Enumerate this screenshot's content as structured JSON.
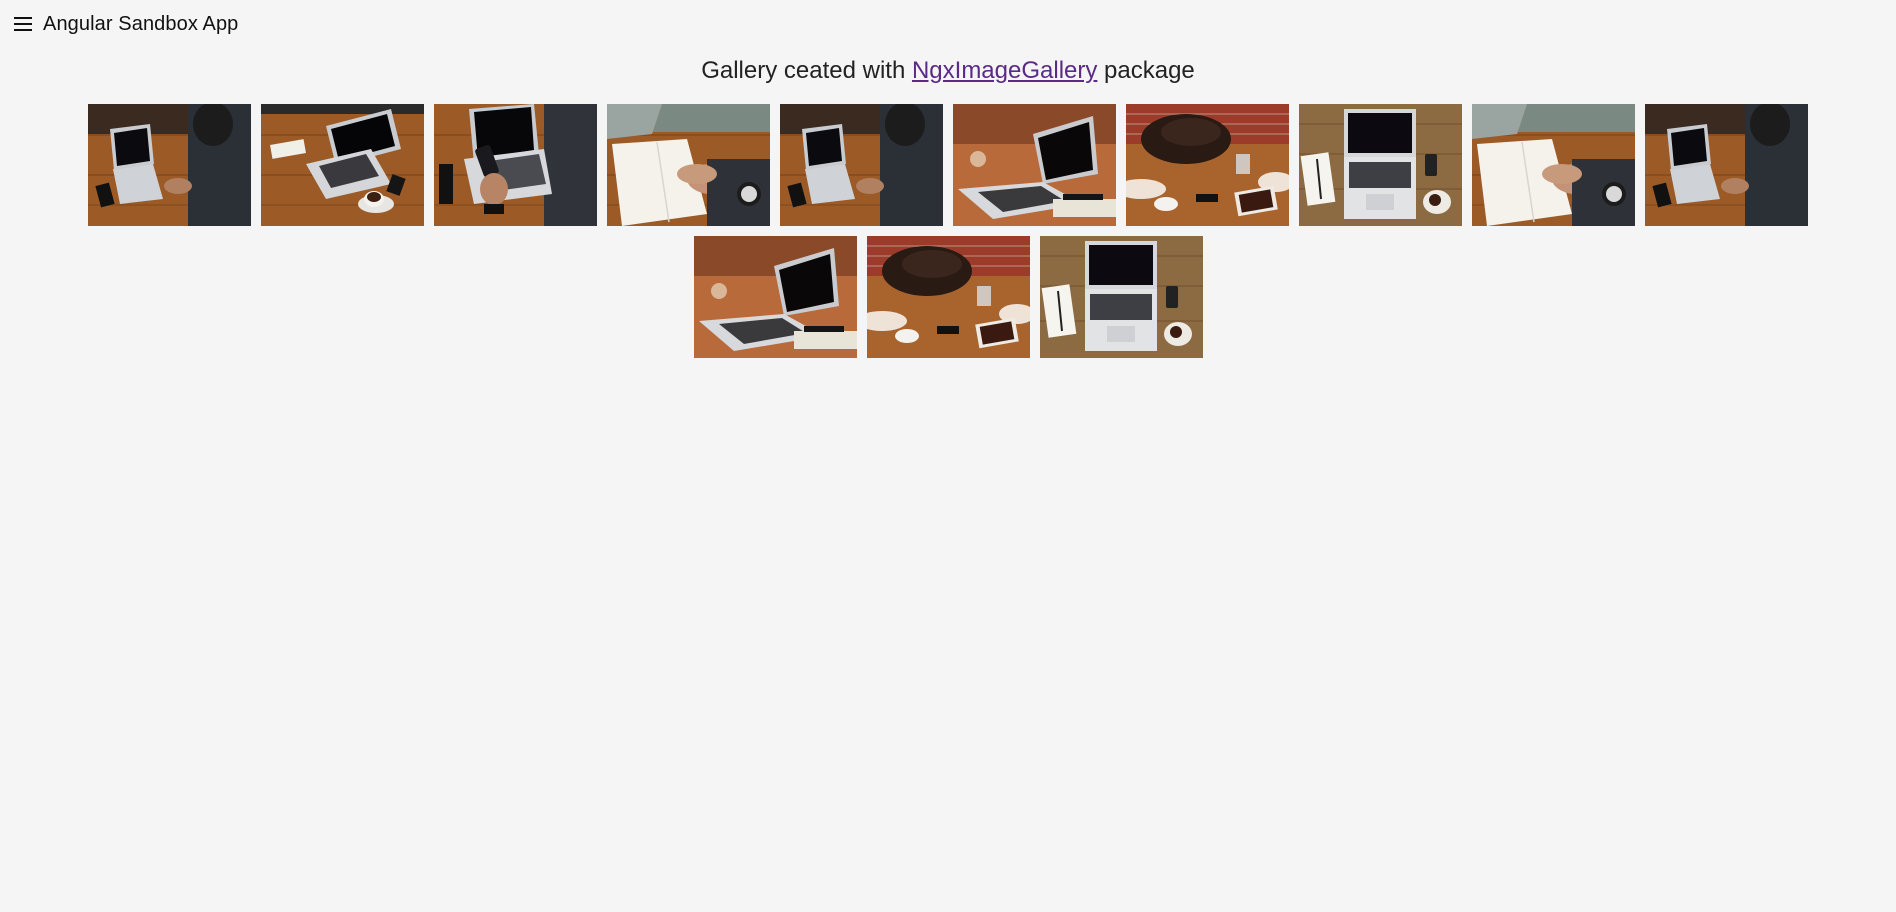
{
  "toolbar": {
    "menu_icon": "menu-icon",
    "title": "Angular Sandbox App"
  },
  "heading": {
    "prefix": "Gallery ceated with ",
    "link_text": "NgxImageGallery",
    "suffix": " package"
  },
  "gallery": {
    "rows": [
      [
        {
          "variant": "dark-right",
          "alt": "laptop-typing"
        },
        {
          "variant": "open-laptop-coffee",
          "alt": "laptop-coffee"
        },
        {
          "variant": "phone-hand",
          "alt": "laptop-phone"
        },
        {
          "variant": "notebook-watch",
          "alt": "notebook-watch"
        },
        {
          "variant": "dark-right",
          "alt": "laptop-typing-2"
        },
        {
          "variant": "laptop-warm",
          "alt": "laptop-side"
        },
        {
          "variant": "brick-bag",
          "alt": "desk-bag"
        },
        {
          "variant": "topdown-laptop",
          "alt": "laptop-topdown"
        },
        {
          "variant": "notebook-watch",
          "alt": "notebook-watch-2"
        },
        {
          "variant": "dark-right",
          "alt": "laptop-typing-3"
        }
      ],
      [
        {
          "variant": "laptop-warm",
          "alt": "laptop-side-2"
        },
        {
          "variant": "brick-bag",
          "alt": "desk-bag-2"
        },
        {
          "variant": "topdown-laptop",
          "alt": "laptop-topdown-2"
        }
      ]
    ]
  },
  "colors": {
    "background": "#f5f5f5",
    "link": "#5a2a86",
    "wood": "#a0622d"
  }
}
